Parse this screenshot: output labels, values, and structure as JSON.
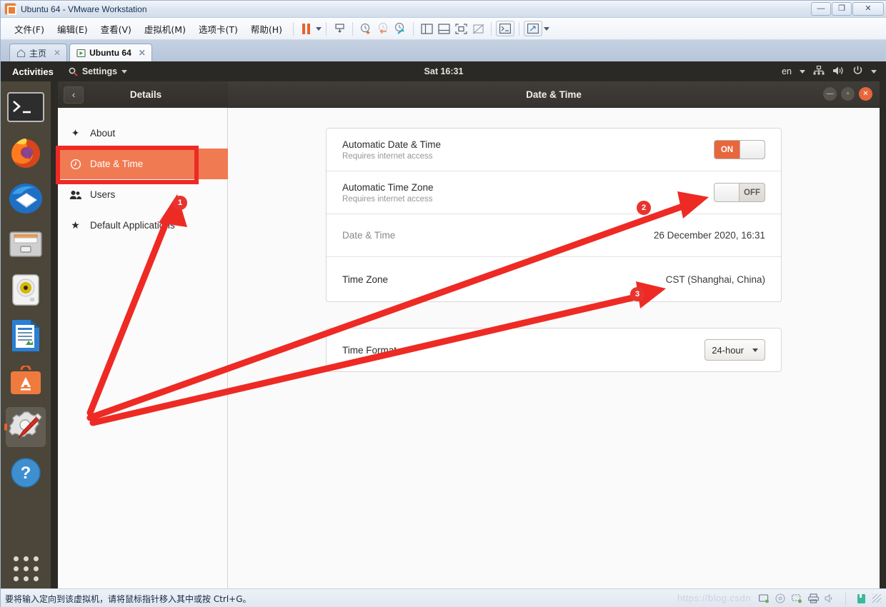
{
  "vmware": {
    "window_title": "Ubuntu 64  - VMware Workstation",
    "app_icon": "vmware-icon",
    "window_buttons": [
      {
        "name": "minimize-button",
        "glyph": "—"
      },
      {
        "name": "restore-button",
        "glyph": "❐"
      },
      {
        "name": "close-button",
        "glyph": "✕"
      }
    ],
    "menus": [
      {
        "label": "文件(F)",
        "name": "menu-file"
      },
      {
        "label": "编辑(E)",
        "name": "menu-edit"
      },
      {
        "label": "查看(V)",
        "name": "menu-view"
      },
      {
        "label": "虚拟机(M)",
        "name": "menu-vm"
      },
      {
        "label": "选项卡(T)",
        "name": "menu-tabs"
      },
      {
        "label": "帮助(H)",
        "name": "menu-help"
      }
    ],
    "toolbar_icons": [
      "pause-button",
      "pause-dropdown-caret",
      "send-ctrl-alt-del-icon",
      "snapshot-take-icon",
      "snapshot-revert-icon",
      "snapshot-manager-icon",
      "show-library-icon",
      "show-thumbnails-icon",
      "fullscreen-icon",
      "unity-mode-icon",
      "console-view-icon",
      "stretch-view-icon",
      "stretch-caret"
    ],
    "tabs": [
      {
        "label": "主页",
        "name": "tab-home",
        "icon": "home-icon",
        "active": false,
        "close": "✕"
      },
      {
        "label": "Ubuntu 64",
        "name": "tab-ubuntu-64",
        "icon": "vm-running-icon",
        "active": true,
        "close": "✕"
      }
    ],
    "status_message": "要将输入定向到该虚拟机，请将鼠标指针移入其中或按 Ctrl+G。",
    "watermark": "https://blog.csdn",
    "status_icons": [
      "hard-disk-icon",
      "cdrom-icon",
      "network-icon",
      "printer-icon",
      "sound-icon",
      "usb-icon",
      "resize-grip"
    ]
  },
  "gnome": {
    "topbar": {
      "activities": "Activities",
      "app_menu": "Settings",
      "app_menu_icon": "settings-app-icon",
      "clock": "Sat 16:31",
      "keyboard_layout": "en",
      "tray_icons": [
        "network-icon",
        "volume-icon",
        "power-icon",
        "tray-caret-icon"
      ]
    },
    "dock": [
      {
        "name": "dock-item-terminal",
        "icon": "terminal-icon",
        "selected": false
      },
      {
        "name": "dock-item-firefox",
        "icon": "firefox-icon",
        "selected": false
      },
      {
        "name": "dock-item-thunderbird",
        "icon": "thunderbird-icon",
        "selected": false
      },
      {
        "name": "dock-item-files",
        "icon": "files-icon",
        "selected": false
      },
      {
        "name": "dock-item-rhythmbox",
        "icon": "rhythmbox-icon",
        "selected": false
      },
      {
        "name": "dock-item-libreoffice-writer",
        "icon": "libreoffice-writer-icon",
        "selected": false
      },
      {
        "name": "dock-item-ubuntu-software",
        "icon": "ubuntu-software-icon",
        "selected": false
      },
      {
        "name": "dock-item-settings",
        "icon": "settings-tools-icon",
        "selected": true
      },
      {
        "name": "dock-item-help",
        "icon": "help-icon",
        "selected": false
      },
      {
        "name": "dock-item-show-applications",
        "icon": "app-grid-icon",
        "selected": false
      }
    ]
  },
  "settings": {
    "back_button": "‹",
    "sidebar_title": "Details",
    "window_title": "Date & Time",
    "window_buttons": [
      {
        "name": "settings-minimize-button",
        "glyph": "—"
      },
      {
        "name": "settings-maximize-button",
        "glyph": "▫"
      },
      {
        "name": "settings-close-button",
        "glyph": "✕"
      }
    ],
    "sidebar_items": [
      {
        "label": "About",
        "name": "sidebar-item-about",
        "icon": "sparkle-icon",
        "active": false
      },
      {
        "label": "Date & Time",
        "name": "sidebar-item-date-time",
        "icon": "clock-icon",
        "active": true
      },
      {
        "label": "Users",
        "name": "sidebar-item-users",
        "icon": "users-icon",
        "active": false
      },
      {
        "label": "Default Applications",
        "name": "sidebar-item-default-applications",
        "icon": "star-icon",
        "active": false
      }
    ],
    "rows": {
      "auto_datetime": {
        "title": "Automatic Date & Time",
        "subtitle": "Requires internet access",
        "toggle_state": "ON"
      },
      "auto_timezone": {
        "title": "Automatic Time Zone",
        "subtitle": "Requires internet access",
        "toggle_state": "OFF"
      },
      "datetime": {
        "title": "Date & Time",
        "value": "26 December 2020, 16:31"
      },
      "timezone": {
        "title": "Time Zone",
        "value": "CST (Shanghai, China)"
      },
      "time_format": {
        "title": "Time Format",
        "value": "24-hour"
      }
    }
  },
  "annotations": {
    "accent_color": "#ee2a24",
    "badges": [
      {
        "label": "1",
        "name": "annotation-badge-1"
      },
      {
        "label": "2",
        "name": "annotation-badge-2"
      },
      {
        "label": "3",
        "name": "annotation-badge-3"
      }
    ]
  }
}
